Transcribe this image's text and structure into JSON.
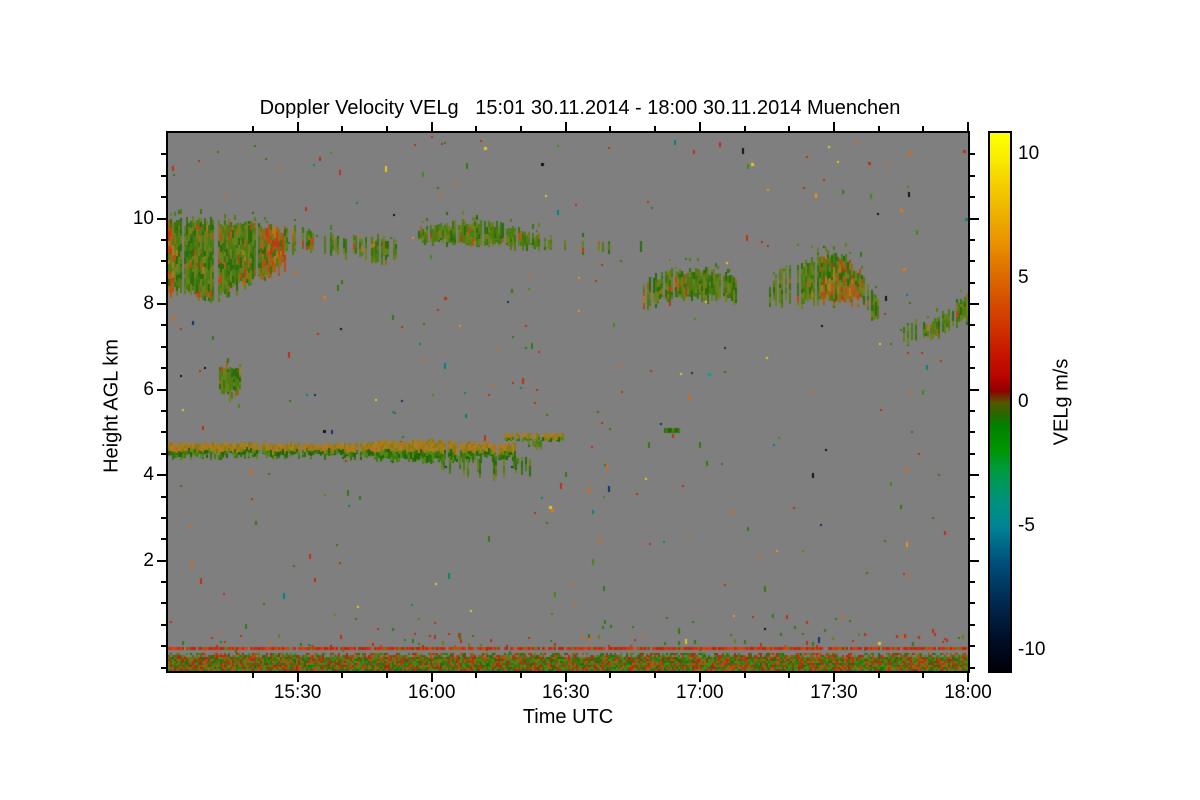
{
  "page": {
    "background": "#ffffff"
  },
  "chart_data": {
    "type": "heatmap",
    "title": "Doppler Velocity VELg   15:01 30.11.2014 - 18:00 30.11.2014 Muenchen",
    "xlabel": "Time UTC",
    "ylabel": "Height AGL km",
    "x_range_hours": [
      15.0167,
      18.0
    ],
    "y_range_km": [
      -0.58,
      12.0
    ],
    "x_ticks": [
      {
        "hours": 15.5,
        "label": "15:30"
      },
      {
        "hours": 16.0,
        "label": "16:00"
      },
      {
        "hours": 16.5,
        "label": "16:30"
      },
      {
        "hours": 17.0,
        "label": "17:00"
      },
      {
        "hours": 17.5,
        "label": "17:30"
      },
      {
        "hours": 18.0,
        "label": "18:00"
      }
    ],
    "x_minor_step_minutes": 10,
    "y_ticks": [
      {
        "km": 2,
        "label": "2"
      },
      {
        "km": 4,
        "label": "4"
      },
      {
        "km": 6,
        "label": "6"
      },
      {
        "km": 8,
        "label": "8"
      },
      {
        "km": 10,
        "label": "10"
      }
    ],
    "y_minor_step_km": 0.5,
    "background_color": "#7f7f7f",
    "colorbar": {
      "label": "VELg m/s",
      "range": [
        -10.85,
        10.85
      ],
      "ticks": [
        {
          "value": 10,
          "label": "10"
        },
        {
          "value": 5,
          "label": "5"
        },
        {
          "value": 0,
          "label": "0"
        },
        {
          "value": -5,
          "label": "-5"
        },
        {
          "value": -10,
          "label": "-10"
        }
      ],
      "minor_step": 1,
      "stops": [
        [
          10.85,
          "#ffff00"
        ],
        [
          10.0,
          "#fbf000"
        ],
        [
          8.0,
          "#f0ba00"
        ],
        [
          6.5,
          "#ea9400"
        ],
        [
          5.0,
          "#dc6800"
        ],
        [
          3.3,
          "#d23a00"
        ],
        [
          1.9,
          "#c81400"
        ],
        [
          1.0,
          "#b80400"
        ],
        [
          0.45,
          "#920000"
        ],
        [
          0.18,
          "#6e3000"
        ],
        [
          -0.05,
          "#515800"
        ],
        [
          -0.45,
          "#2c6400"
        ],
        [
          -0.95,
          "#028000"
        ],
        [
          -1.9,
          "#009600"
        ],
        [
          -2.75,
          "#009a40"
        ],
        [
          -4.0,
          "#00927c"
        ],
        [
          -5.0,
          "#008494"
        ],
        [
          -6.4,
          "#00527c"
        ],
        [
          -8.0,
          "#002a52"
        ],
        [
          -9.6,
          "#000e28"
        ],
        [
          -10.85,
          "#000008"
        ]
      ]
    },
    "palettes": {
      "cirrus_green": [
        "#4a7d12",
        "#3a7310",
        "#63811c",
        "#71801e",
        "#2c6a0c",
        "#567a14"
      ],
      "cirrus_orange": [
        "#a5641a",
        "#b55314",
        "#c34412",
        "#936d18",
        "#ad7a20",
        "#b93c10"
      ],
      "olive": [
        "#6f7a18",
        "#7d7e1c",
        "#5f7514",
        "#8a7c20"
      ],
      "tan": [
        "#8a7a16",
        "#9c7e1e",
        "#ac7e26",
        "#b0741e"
      ],
      "green": [
        "#3f7a10",
        "#2f6e0c",
        "#4f8a18",
        "#246208"
      ],
      "redline": [
        "#c03010",
        "#cc3a10",
        "#b22a0a",
        "#d44414"
      ],
      "ground": [
        [
          "#b03410",
          0.17
        ],
        [
          "#c24712",
          0.13
        ],
        [
          "#983010",
          0.08
        ],
        [
          "#2e7a10",
          0.2
        ],
        [
          "#3f8a14",
          0.16
        ],
        [
          "#1f6e0a",
          0.1
        ],
        [
          "#6e7c16",
          0.09
        ],
        [
          "#8a5a16",
          0.07
        ]
      ],
      "speckle": [
        [
          "#c03010",
          0.2
        ],
        [
          "#d86a14",
          0.13
        ],
        [
          "#e8c810",
          0.07
        ],
        [
          "#2f7a10",
          0.28
        ],
        [
          "#3f8a14",
          0.1
        ],
        [
          "#00857a",
          0.07
        ],
        [
          "#101010",
          0.06
        ],
        [
          "#12306a",
          0.04
        ],
        [
          "#e89018",
          0.05
        ]
      ],
      "lowspeckle": [
        [
          "#c03010",
          0.4
        ],
        [
          "#2f7a10",
          0.35
        ],
        [
          "#6e7c16",
          0.15
        ],
        [
          "#d86a14",
          0.1
        ]
      ]
    },
    "features": [
      {
        "kind": "cloud",
        "label": "cirrus-deck-main",
        "t": [
          15.017,
          15.45
        ],
        "top": [
          [
            15.017,
            9.95
          ],
          [
            15.25,
            9.9
          ],
          [
            15.45,
            9.72
          ]
        ],
        "bot": [
          [
            15.017,
            8.25
          ],
          [
            15.2,
            8.12
          ],
          [
            15.35,
            8.6
          ],
          [
            15.45,
            8.85
          ]
        ],
        "density": 0.97,
        "jt": 5,
        "jb": 7,
        "orange": 0.42
      },
      {
        "kind": "cloud",
        "label": "cirrus-thin-edge",
        "t": [
          15.45,
          15.63
        ],
        "top": [
          [
            15.45,
            9.8
          ],
          [
            15.63,
            9.6
          ]
        ],
        "bot": [
          [
            15.45,
            9.25
          ],
          [
            15.63,
            9.15
          ]
        ],
        "density": 0.55,
        "jt": 4,
        "jb": 5,
        "orange": 0.15
      },
      {
        "kind": "cloud",
        "label": "cirrus-patch-1540",
        "t": [
          15.64,
          15.87
        ],
        "top": [
          [
            15.64,
            9.5
          ],
          [
            15.75,
            9.6
          ],
          [
            15.87,
            9.45
          ]
        ],
        "bot": [
          [
            15.64,
            9.1
          ],
          [
            15.87,
            9.0
          ]
        ],
        "density": 0.6,
        "jt": 4,
        "jb": 5,
        "orange": 0.12
      },
      {
        "kind": "cloud",
        "label": "cirrus-band-1600",
        "t": [
          15.95,
          16.4
        ],
        "top": [
          [
            15.95,
            9.75
          ],
          [
            16.1,
            9.9
          ],
          [
            16.25,
            9.85
          ],
          [
            16.4,
            9.6
          ]
        ],
        "bot": [
          [
            15.95,
            9.45
          ],
          [
            16.2,
            9.4
          ],
          [
            16.4,
            9.3
          ]
        ],
        "density": 0.8,
        "jt": 4,
        "jb": 4,
        "orange": 0.1
      },
      {
        "kind": "cloud",
        "label": "cirrus-scatter-1630",
        "t": [
          16.42,
          16.78
        ],
        "top": [
          [
            16.42,
            9.5
          ],
          [
            16.78,
            9.4
          ]
        ],
        "bot": [
          [
            16.42,
            9.25
          ],
          [
            16.78,
            9.15
          ]
        ],
        "density": 0.2,
        "jt": 3,
        "jb": 4,
        "orange": 0.05
      },
      {
        "kind": "cloud",
        "label": "cloud-patch-1700",
        "t": [
          16.79,
          17.14
        ],
        "top": [
          [
            16.79,
            8.5
          ],
          [
            16.9,
            8.8
          ],
          [
            17.05,
            8.75
          ],
          [
            17.14,
            8.6
          ]
        ],
        "bot": [
          [
            16.79,
            7.95
          ],
          [
            16.9,
            8.1
          ],
          [
            17.14,
            8.1
          ]
        ],
        "density": 0.85,
        "jt": 4,
        "jb": 5,
        "orange": 0.1
      },
      {
        "kind": "cloud",
        "label": "cloud-blobs-1716",
        "t": [
          17.26,
          17.38
        ],
        "top": [
          [
            17.26,
            8.5
          ],
          [
            17.32,
            8.85
          ],
          [
            17.38,
            8.8
          ]
        ],
        "bot": [
          [
            17.26,
            8.0
          ],
          [
            17.38,
            7.95
          ]
        ],
        "density": 0.6,
        "jt": 5,
        "jb": 6,
        "orange": 0.08
      },
      {
        "kind": "cloud",
        "label": "cloud-mass-1730",
        "t": [
          17.38,
          17.61
        ],
        "top": [
          [
            17.38,
            8.9
          ],
          [
            17.45,
            9.2
          ],
          [
            17.55,
            9.05
          ],
          [
            17.61,
            8.6
          ]
        ],
        "bot": [
          [
            17.38,
            8.0
          ],
          [
            17.61,
            8.05
          ]
        ],
        "density": 0.92,
        "jt": 5,
        "jb": 5,
        "orange": 0.18
      },
      {
        "kind": "cloud",
        "label": "updraft-core-1730",
        "t": [
          17.47,
          17.58
        ],
        "top": [
          [
            17.47,
            8.45
          ]
        ],
        "bot": [
          [
            17.47,
            8.12
          ]
        ],
        "density": 0.75,
        "jt": 3,
        "jb": 3,
        "orange": 0.85
      },
      {
        "kind": "cloud",
        "label": "descending-tail",
        "t": [
          17.61,
          17.69
        ],
        "top": [
          [
            17.61,
            8.55
          ],
          [
            17.69,
            8.0
          ]
        ],
        "bot": [
          [
            17.61,
            7.95
          ],
          [
            17.69,
            7.35
          ]
        ],
        "density": 0.5,
        "jt": 4,
        "jb": 6,
        "orange": 0.08
      },
      {
        "kind": "cloud",
        "label": "cloud-dip-1748",
        "t": [
          17.73,
          17.85
        ],
        "top": [
          [
            17.73,
            7.5
          ],
          [
            17.85,
            7.6
          ]
        ],
        "bot": [
          [
            17.73,
            7.0
          ],
          [
            17.85,
            7.15
          ]
        ],
        "density": 0.55,
        "jt": 5,
        "jb": 5,
        "orange": 0.05
      },
      {
        "kind": "cloud",
        "label": "cloud-rise-1800",
        "t": [
          17.86,
          18.0
        ],
        "top": [
          [
            17.86,
            7.55
          ],
          [
            17.93,
            7.8
          ],
          [
            18.0,
            8.2
          ]
        ],
        "bot": [
          [
            17.86,
            7.2
          ],
          [
            18.0,
            7.6
          ]
        ],
        "density": 0.8,
        "jt": 5,
        "jb": 5,
        "orange": 0.12
      },
      {
        "kind": "cloud",
        "label": "blob-6km-olive-top",
        "t": [
          15.205,
          15.24
        ],
        "top": [
          [
            15.205,
            6.62
          ]
        ],
        "bot": [
          [
            15.205,
            6.42
          ]
        ],
        "density": 0.55,
        "jt": 2,
        "jb": 2,
        "orange": 0.5,
        "pal": "olive"
      },
      {
        "kind": "cloud",
        "label": "blob-6km",
        "t": [
          15.21,
          15.29
        ],
        "top": [
          [
            15.21,
            6.5
          ]
        ],
        "bot": [
          [
            15.21,
            5.95
          ]
        ],
        "density": 0.85,
        "jt": 3,
        "jb": 4,
        "orange": 0.15
      },
      {
        "kind": "cloud",
        "label": "blob-6km-tail",
        "t": [
          15.24,
          15.265
        ],
        "top": [
          [
            15.24,
            5.95
          ]
        ],
        "bot": [
          [
            15.24,
            5.75
          ]
        ],
        "density": 0.7,
        "jt": 1,
        "jb": 3,
        "orange": 0
      },
      {
        "kind": "layer",
        "label": "midlevel-layer-5km",
        "t": [
          15.017,
          16.31
        ],
        "top": [
          [
            15.017,
            4.74
          ],
          [
            15.6,
            4.72
          ],
          [
            16.0,
            4.8
          ],
          [
            16.31,
            4.72
          ]
        ],
        "bot": [
          [
            15.017,
            4.42
          ],
          [
            15.5,
            4.46
          ],
          [
            16.0,
            4.32
          ],
          [
            16.31,
            4.42
          ]
        ],
        "split": 0.45,
        "density": 0.96,
        "jt": 2,
        "jb": 4
      },
      {
        "kind": "cloud",
        "label": "virga-wisps",
        "t": [
          16.02,
          16.37
        ],
        "top": [
          [
            16.02,
            4.42
          ],
          [
            16.37,
            4.4
          ]
        ],
        "bot": [
          [
            16.02,
            4.15
          ],
          [
            16.2,
            4.0
          ],
          [
            16.37,
            4.15
          ]
        ],
        "density": 0.4,
        "jt": 2,
        "jb": 8,
        "orange": 0
      },
      {
        "kind": "layer",
        "label": "segment-5_25km",
        "t": [
          16.27,
          16.49
        ],
        "top": [
          [
            16.27,
            4.96
          ]
        ],
        "bot": [
          [
            16.27,
            4.8
          ]
        ],
        "split": 0.5,
        "density": 0.9,
        "jt": 1,
        "jb": 1
      },
      {
        "kind": "cloud",
        "label": "green-blip",
        "t": [
          16.36,
          16.41
        ],
        "top": [
          [
            16.36,
            4.8
          ]
        ],
        "bot": [
          [
            16.36,
            4.64
          ]
        ],
        "density": 0.8,
        "jt": 1,
        "jb": 2,
        "orange": 0
      },
      {
        "kind": "cloud",
        "label": "green-dash-5_4km",
        "t": [
          16.868,
          16.925
        ],
        "top": [
          [
            16.868,
            5.1
          ]
        ],
        "bot": [
          [
            16.868,
            4.99
          ]
        ],
        "density": 0.95,
        "jt": 0,
        "jb": 0,
        "orange": 0,
        "pal": "green"
      },
      {
        "kind": "speckleband",
        "label": "near-ground-speckle",
        "y": [
          480,
          500
        ],
        "density": 0.04
      },
      {
        "kind": "speckleband",
        "label": "pre-clutter-speckle",
        "y": [
          500,
          514
        ],
        "density": 0.12
      },
      {
        "kind": "hline",
        "label": "clutter-line-0km",
        "h": -0.05,
        "thick": 3
      },
      {
        "kind": "noiseband",
        "label": "surface-noise-band",
        "hrange": [
          -0.58,
          -0.17
        ]
      }
    ],
    "speckles": {
      "count": 300,
      "notable": [
        [
          316,
          14,
          "#e8c810"
        ],
        [
          381,
          373,
          "#e8c810"
        ],
        [
          383,
          376,
          "#e07818"
        ],
        [
          735,
          135,
          "#e07818"
        ],
        [
          795,
          17,
          "#c03010"
        ],
        [
          797,
          85,
          "#00857a"
        ],
        [
          583,
          30,
          "#e8c810"
        ],
        [
          276,
          164,
          "#c03010"
        ],
        [
          155,
          163,
          "#e07818"
        ],
        [
          700,
          29,
          "#c03010"
        ],
        [
          373,
          30,
          "#101010"
        ],
        [
          540,
          240,
          "#00a0a0"
        ],
        [
          732,
          76,
          "#e07818"
        ],
        [
          155,
          297,
          "#101010"
        ],
        [
          710,
          509,
          "#e8c810"
        ]
      ]
    }
  }
}
